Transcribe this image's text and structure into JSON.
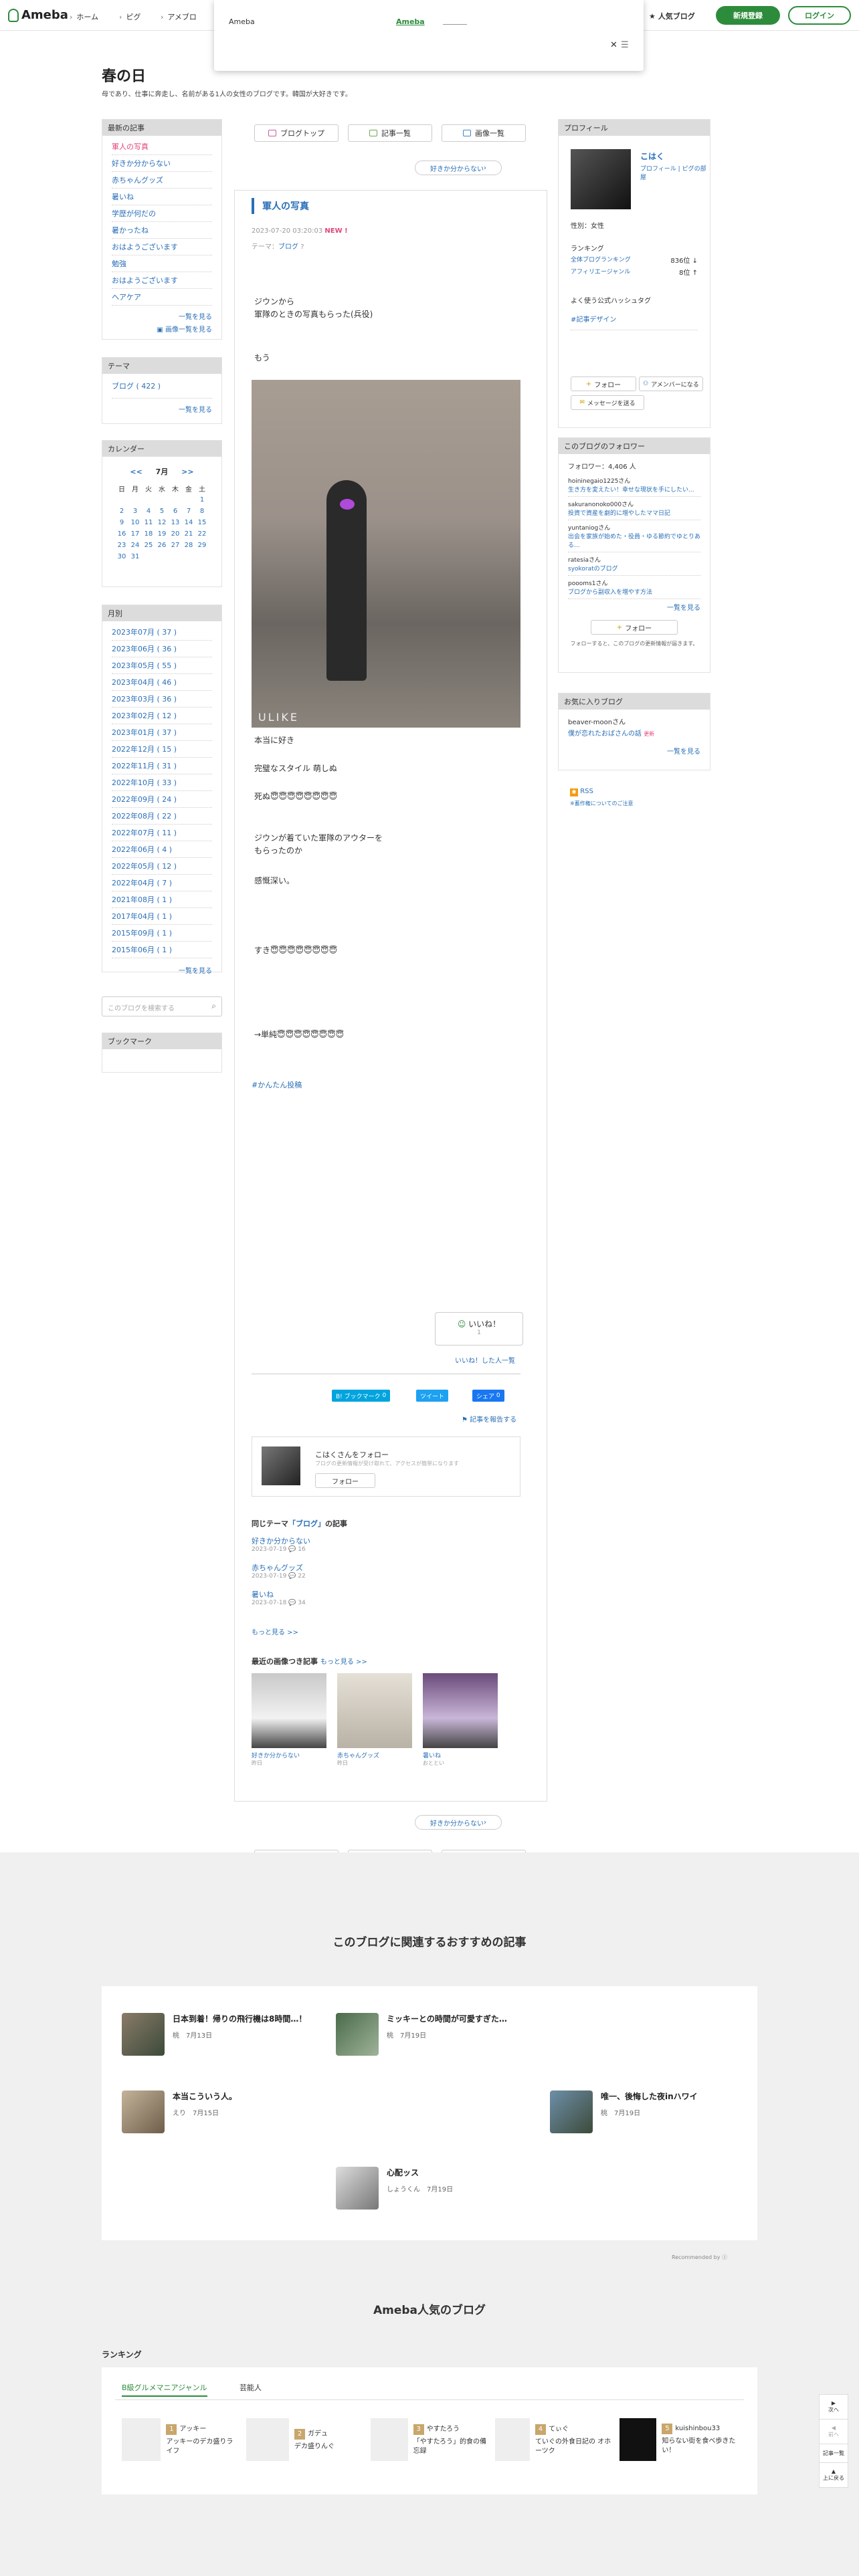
{
  "header": {
    "logo": "Ameba",
    "nav": [
      "ホーム",
      "ピグ",
      "アメブロ"
    ],
    "popup_title": "Ameba",
    "popup_link": "Ameba",
    "popular": "人気ブログ",
    "signup": "新規登録",
    "login": "ログイン"
  },
  "blog": {
    "title": "春の日",
    "description": "母であり、仕事に奔走し、名前がある1人の女性のブログです。韓国が大好きです。"
  },
  "sidebar_left": {
    "recent_title": "最新の記事",
    "recent": [
      "軍人の写真",
      "好きか分からない",
      "赤ちゃんグッズ",
      "暑いね",
      "学歴が何だの",
      "暑かったね",
      "おはようございます",
      "勉強",
      "おはようございます",
      "ヘアケア"
    ],
    "recent_more": "一覧を見る",
    "image_list": "画像一覧を見る",
    "theme_title": "テーマ",
    "theme_item": "ブログ ( 422 )",
    "theme_more": "一覧を見る",
    "calendar_title": "カレンダー",
    "calendar_prev": "<<",
    "calendar_month": "7月",
    "calendar_next": ">>",
    "weekdays": [
      "日",
      "月",
      "火",
      "水",
      "木",
      "金",
      "土"
    ],
    "calendar_rows": [
      [
        "",
        "",
        "",
        "",
        "",
        "",
        "1"
      ],
      [
        "2",
        "3",
        "4",
        "5",
        "6",
        "7",
        "8"
      ],
      [
        "9",
        "10",
        "11",
        "12",
        "13",
        "14",
        "15"
      ],
      [
        "16",
        "17",
        "18",
        "19",
        "20",
        "21",
        "22"
      ],
      [
        "23",
        "24",
        "25",
        "26",
        "27",
        "28",
        "29"
      ],
      [
        "30",
        "31",
        "",
        "",
        "",
        "",
        ""
      ]
    ],
    "monthly_title": "月別",
    "monthly": [
      "2023年07月 ( 37 )",
      "2023年06月 ( 36 )",
      "2023年05月 ( 55 )",
      "2023年04月 ( 46 )",
      "2023年03月 ( 36 )",
      "2023年02月 ( 12 )",
      "2023年01月 ( 37 )",
      "2022年12月 ( 15 )",
      "2022年11月 ( 31 )",
      "2022年10月 ( 33 )",
      "2022年09月 ( 24 )",
      "2022年08月 ( 22 )",
      "2022年07月 ( 11 )",
      "2022年06月 ( 4 )",
      "2022年05月 ( 12 )",
      "2022年04月 ( 7 )",
      "2021年08月 ( 1 )",
      "2017年04月 ( 1 )",
      "2015年09月 ( 1 )",
      "2015年06月 ( 1 )"
    ],
    "monthly_more": "一覧を見る",
    "search_placeholder": "このブログを検索する",
    "bookmark_title": "ブックマーク"
  },
  "top_buttons": {
    "top": "ブログトップ",
    "list": "記事一覧",
    "images": "画像一覧"
  },
  "prev_article": "好きか分からない",
  "article": {
    "title": "軍人の写真",
    "date": "2023-07-20 03:20:03",
    "new_badge": "NEW !",
    "theme": "テーマ：",
    "theme_link": "ブログ",
    "p1": "ジウンから\n軍隊のときの写真もらった(兵役)",
    "p2": "もう",
    "p3": "本当に好き",
    "p4": "完璧なスタイル 萌しぬ",
    "p5": "死ぬ😇😇😇😇😇😇😇😇",
    "p6": "ジウンが着ていた軍隊のアウターを\nもらったのか",
    "p7": "感慨深い。",
    "p8": "すき😇😇😇😇😇😇😇😇",
    "p9": "→単純😇😇😇😇😇😇😇😇",
    "hashtag": "#かんたん投稿",
    "like": "いいね！",
    "like_count": "1",
    "like_list": "いいね！した人一覧",
    "hatena": "B! ブックマーク",
    "hatena_count": "0",
    "tweet": "ツイート",
    "fb_share": "シェア",
    "fb_count": "0",
    "report": "記事を報告する",
    "follow_card_title": "こはくさんをフォロー",
    "follow_card_desc": "ブログの更新情報が受け取れて、アクセスが簡単になります",
    "follow_card_btn": "フォロー",
    "same_theme_prefix": "同じテーマ",
    "same_theme_name": "「ブログ」",
    "same_theme_suffix": "の記事",
    "related": [
      {
        "title": "好きか分からない",
        "date": "2023-07-19",
        "count": "16"
      },
      {
        "title": "赤ちゃんグッズ",
        "date": "2023-07-19",
        "count": "22"
      },
      {
        "title": "暑いね",
        "date": "2023-07-18",
        "count": "34"
      }
    ],
    "more": "もっと見る >>",
    "recent_images": "最近の画像つき記事",
    "recent_images_more": "もっと見る >>",
    "images": [
      {
        "title": "好きか分からない",
        "sub": "昨日"
      },
      {
        "title": "赤ちゃんグッズ",
        "sub": "昨日"
      },
      {
        "title": "暑いね",
        "sub": "おととい"
      }
    ]
  },
  "profile": {
    "title": "プロフィール",
    "name": "こはく",
    "links": "プロフィール | ピグの部屋",
    "gender": "性別：女性",
    "ranking": "ランキング",
    "rank_all": "全体ブログランキング",
    "rank_all_val": "836位 ↓",
    "rank_genre": "アフィリエージャンル",
    "rank_genre_val": "8位 ↑",
    "hashtag_title": "よく使う公式ハッシュタグ",
    "hashtag": "#記事デザイン",
    "follow": "フォロー",
    "amember": "アメンバーになる",
    "message": "メッセージを送る"
  },
  "followers": {
    "title": "このブログのフォロワー",
    "count": "フォロワー：4,406 人",
    "list": [
      {
        "name": "hoininegaio1225さん",
        "blog": "生き方を変えたい！幸せな現状を手にしたい..."
      },
      {
        "name": "sakuranonoko000さん",
        "blog": "投資で資産を劇的に増やしたママ日記"
      },
      {
        "name": "yuntaniogさん",
        "blog": "出会を家族が始めた・役員・ゆる節約でゆとりある..."
      },
      {
        "name": "ratesiaさん",
        "blog": "syokoratのブログ"
      },
      {
        "name": "poooms1さん",
        "blog": "ブログから副収入を増やす方法"
      }
    ],
    "more": "一覧を見る",
    "follow": "フォロー",
    "note": "フォローすると、このブログの更新情報が届きます。"
  },
  "favorites": {
    "title": "お気に入りブログ",
    "name": "beaver-moonさん",
    "blog": "僕が恋れたおばさんの話",
    "badge": "更新",
    "more": "一覧を見る"
  },
  "rss": {
    "label": "RSS",
    "note": "※蓄作権についてのご注意"
  },
  "bottom": {
    "recommend_title": "このブログに関連するおすすめの記事",
    "recommend": [
      {
        "title": "日本到着！帰りの飛行機は8時間…！",
        "author": "桃",
        "date": "7月13日"
      },
      {
        "title": "ミッキーとの時間が可愛すぎた…",
        "author": "桃",
        "date": "7月19日"
      },
      {
        "title": "本当こういう人。",
        "author": "えり",
        "date": "7月15日"
      },
      {
        "title": "唯一、後悔した夜inハワイ",
        "author": "桃",
        "date": "7月19日"
      },
      {
        "title": "心配ッス",
        "author": "しょうくん",
        "date": "7月19日"
      }
    ],
    "recommend_by": "Recommended by",
    "popular_title": "Ameba人気のブログ",
    "ranking": "ランキング",
    "tabs": [
      "B級グルメマニアジャンル",
      "芸能人"
    ],
    "ranks": [
      {
        "n": "1",
        "name": "アッキー",
        "desc": "アッキーのデカ盛りライフ"
      },
      {
        "n": "2",
        "name": "ガデュ",
        "desc": "デカ盛りんぐ"
      },
      {
        "n": "3",
        "name": "やすたろう",
        "desc": "「やすたろう」的食の備忘録"
      },
      {
        "n": "4",
        "name": "てぃぐ",
        "desc": "ていぐの外食日記の オホーツク"
      },
      {
        "n": "5",
        "name": "kuishinbou33",
        "desc": "知らない街を食べ歩きたい！"
      }
    ],
    "side_btns": [
      "次へ",
      "前へ",
      "記事一覧",
      "上に戻る"
    ]
  }
}
